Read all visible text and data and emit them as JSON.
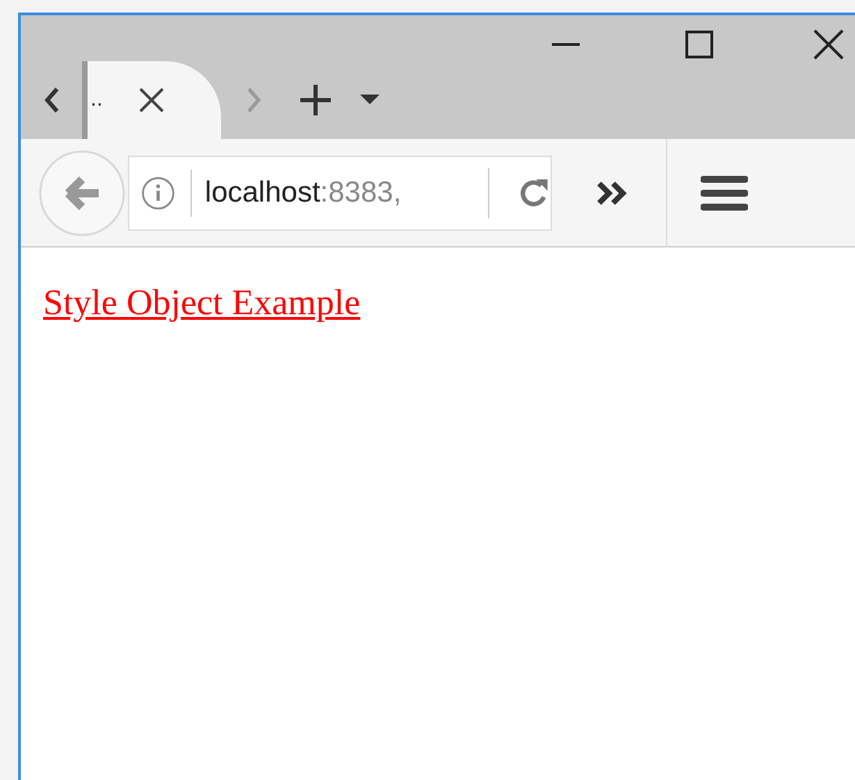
{
  "tab": {
    "title": "..",
    "selected": true
  },
  "address_bar": {
    "host": "localhost",
    "rest": ":8383,"
  },
  "page": {
    "link": "Style Object Example"
  }
}
